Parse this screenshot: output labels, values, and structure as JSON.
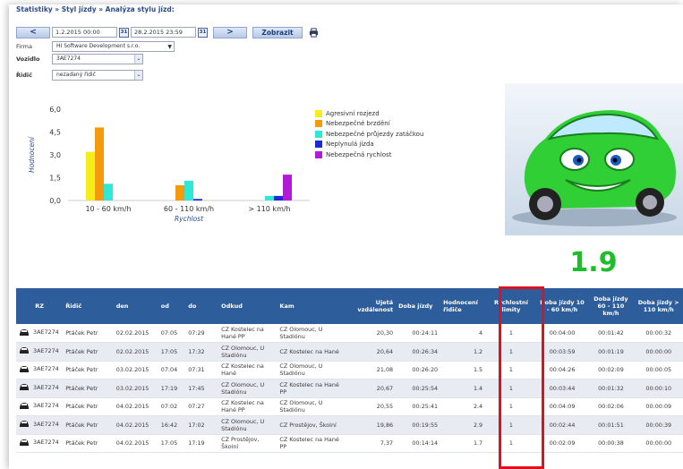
{
  "breadcrumb": "Statistiky » Styl jízdy » Analýza stylu jízd:",
  "toolbar": {
    "prev_label": "<",
    "date_from": "1.2.2015 00:00",
    "date_to": "28.2.2015 23:59",
    "next_label": ">",
    "show_label": "Zobrazit",
    "calendar_icon_text": "31"
  },
  "filters": {
    "firma_label": "Firma",
    "firma_value": "HI Software Development s.r.o.",
    "vozidlo_label": "Vozidlo",
    "vozidlo_value": "3AE7274",
    "ridic_label": "Řidič",
    "ridic_value": "nezadaný řidič"
  },
  "colors": {
    "agresivni": "#f5ec1c",
    "brzdeni": "#f59a0c",
    "zatacka": "#2fe8d6",
    "neplynula": "#1a2bd6",
    "rychlost": "#b31ad6",
    "header": "#2d5d9a",
    "score": "#1fbd2b"
  },
  "chart_data": {
    "type": "bar",
    "categories": [
      "10 - 60 km/h",
      "60 - 110 km/h",
      "> 110 km/h"
    ],
    "series": [
      {
        "name": "Agresivní rozjezd",
        "values": [
          3.2,
          0,
          0
        ]
      },
      {
        "name": "Nebezpečné brzdění",
        "values": [
          4.8,
          1.0,
          0
        ]
      },
      {
        "name": "Nebezpečné průjezdy zatáčkou",
        "values": [
          1.1,
          1.3,
          0.3
        ]
      },
      {
        "name": "Neplynulá jízda",
        "values": [
          0,
          0.1,
          0.3
        ]
      },
      {
        "name": "Nebezpečná rychlost",
        "values": [
          0,
          0,
          1.7
        ]
      }
    ],
    "yticks": [
      "6,0",
      "4,5",
      "3,0",
      "1,5",
      "0,0"
    ],
    "ylabel": "Hodnocení",
    "xlabel": "Rychlost",
    "ylim": [
      0,
      6
    ]
  },
  "score": "1.9",
  "table": {
    "headers": [
      "RZ",
      "Řidič",
      "den",
      "od",
      "do",
      "Odkud",
      "Kam",
      "Ujetá vzdálenost",
      "Doba jízdy",
      "Hodnocení řidiče",
      "Rychlostní limity",
      "Doba jízdy 10 - 60 km/h",
      "Doba jízdy 60 - 110 km/h",
      "Doba jízdy > 110 km/h"
    ],
    "rows": [
      [
        "3AE7274",
        "Ptáček Petr",
        "02.02.2015",
        "07:05",
        "07:29",
        "CZ Kostelec na Hané PP",
        "CZ Olomouc, U Stadiónu",
        "20,30",
        "00:24:11",
        "4",
        "1",
        "00:04:00",
        "00:01:42",
        "00:00:32"
      ],
      [
        "3AE7274",
        "Ptáček Petr",
        "02.02.2015",
        "17:05",
        "17:32",
        "CZ Olomouc, U Stadiónu",
        "CZ Kostelec na Hané",
        "20,64",
        "00:26:34",
        "1.2",
        "1",
        "00:03:59",
        "00:01:19",
        "00:00:00"
      ],
      [
        "3AE7274",
        "Ptáček Petr",
        "03.02.2015",
        "07:04",
        "07:31",
        "CZ Kostelec na Hané",
        "CZ Olomouc, U Stadiónu",
        "21,08",
        "00:26:20",
        "1.5",
        "1",
        "00:04:26",
        "00:02:09",
        "00:00:05"
      ],
      [
        "3AE7274",
        "Ptáček Petr",
        "03.02.2015",
        "17:19",
        "17:45",
        "CZ Olomouc, U Stadiónu",
        "CZ Kostelec na Hané PP",
        "20,67",
        "00:25:54",
        "1.4",
        "1",
        "00:03:44",
        "00:01:32",
        "00:00:10"
      ],
      [
        "3AE7274",
        "Ptáček Petr",
        "04.02.2015",
        "07:02",
        "07:27",
        "CZ Kostelec na Hané PP",
        "CZ Olomouc, U Stadiónu",
        "20,55",
        "00:25:41",
        "2.4",
        "1",
        "00:04:09",
        "00:02:06",
        "00:00:09"
      ],
      [
        "3AE7274",
        "Ptáček Petr",
        "04.02.2015",
        "16:42",
        "17:02",
        "CZ Olomouc, U Stadiónu",
        "CZ Prostějov, Školní",
        "19,86",
        "00:19:55",
        "2.9",
        "1",
        "00:02:44",
        "00:01:51",
        "00:00:39"
      ],
      [
        "3AE7274",
        "Ptáček Petr",
        "04.02.2015",
        "17:05",
        "17:19",
        "CZ Prostějov, Školní",
        "CZ Kostelec na Hané PP",
        "7,37",
        "00:14:14",
        "1.7",
        "1",
        "00:02:09",
        "00:00:38",
        "00:00:00"
      ]
    ]
  }
}
